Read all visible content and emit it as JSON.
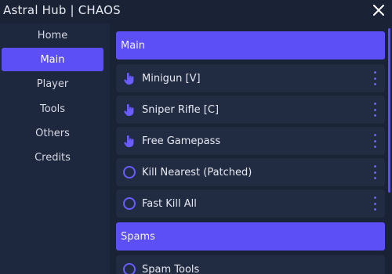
{
  "window": {
    "title": "Astral Hub | CHAOS"
  },
  "sidebar": {
    "items": [
      {
        "label": "Home"
      },
      {
        "label": "Main"
      },
      {
        "label": "Player"
      },
      {
        "label": "Tools"
      },
      {
        "label": "Others"
      },
      {
        "label": "Credits"
      }
    ],
    "active": "Main"
  },
  "sections": [
    {
      "label": "Main"
    },
    {
      "label": "Spams"
    }
  ],
  "main_items": [
    {
      "label": "Minigun [V]",
      "icon": "pointer-hand-icon"
    },
    {
      "label": "Sniper Rifle [C]",
      "icon": "pointer-hand-icon"
    },
    {
      "label": "Free Gamepass",
      "icon": "pointer-hand-icon"
    },
    {
      "label": "Kill Nearest (Patched)",
      "icon": "toggle-circle-icon"
    },
    {
      "label": "Fast Kill All",
      "icon": "toggle-circle-icon"
    }
  ],
  "spams_items": [
    {
      "label": "Spam Tools",
      "icon": "toggle-circle-icon"
    }
  ],
  "colors": {
    "accent": "#5b4ff5",
    "background": "#1a2236",
    "sidebar": "#1d273d",
    "row": "#212b42"
  }
}
